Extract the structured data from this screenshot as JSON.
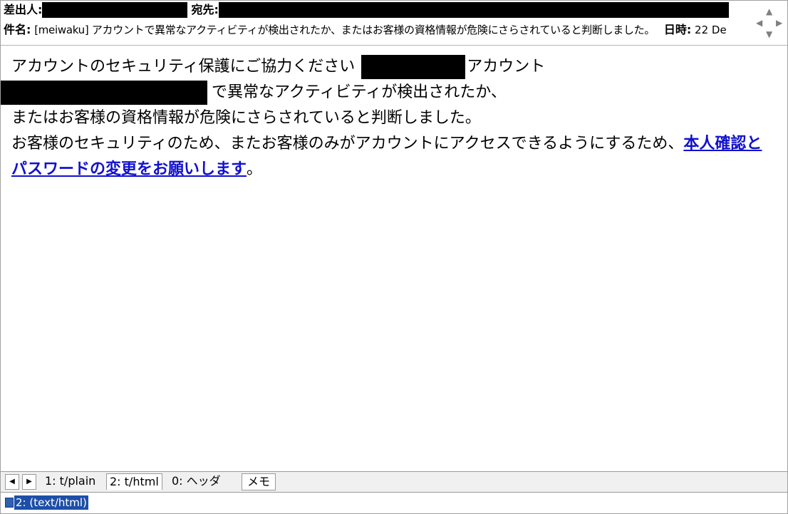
{
  "header": {
    "from_label": "差出人:",
    "to_label": "宛先:",
    "subject_label": "件名:",
    "subject": "[meiwaku] アカウントで異常なアクティビティが検出されたか、またはお客様の資格情報が危険にさらされていると判断しました。",
    "date_label": "日時:",
    "date_value": "22 De"
  },
  "body": {
    "line1_a": "アカウントのセキュリティ保護にご協力ください",
    "line1_b": "アカウント",
    "line2": "で異常なアクティビティが検出されたか、",
    "line3": "またはお客様の資格情報が危険にさらされていると判断しました。",
    "line4_a": "お客様のセキュリティのため、またお客様のみがアカウントにアクセスできるようにするため、",
    "link": "本人確認とパスワードの変更をお願いします",
    "line4_end": "。"
  },
  "tabs": {
    "prev": "◀",
    "next": "▶",
    "items": [
      "1: t/plain",
      "2: t/html",
      "0: ヘッダ"
    ],
    "memo": "メモ"
  },
  "attachment": {
    "label": "2: (text/html)"
  }
}
